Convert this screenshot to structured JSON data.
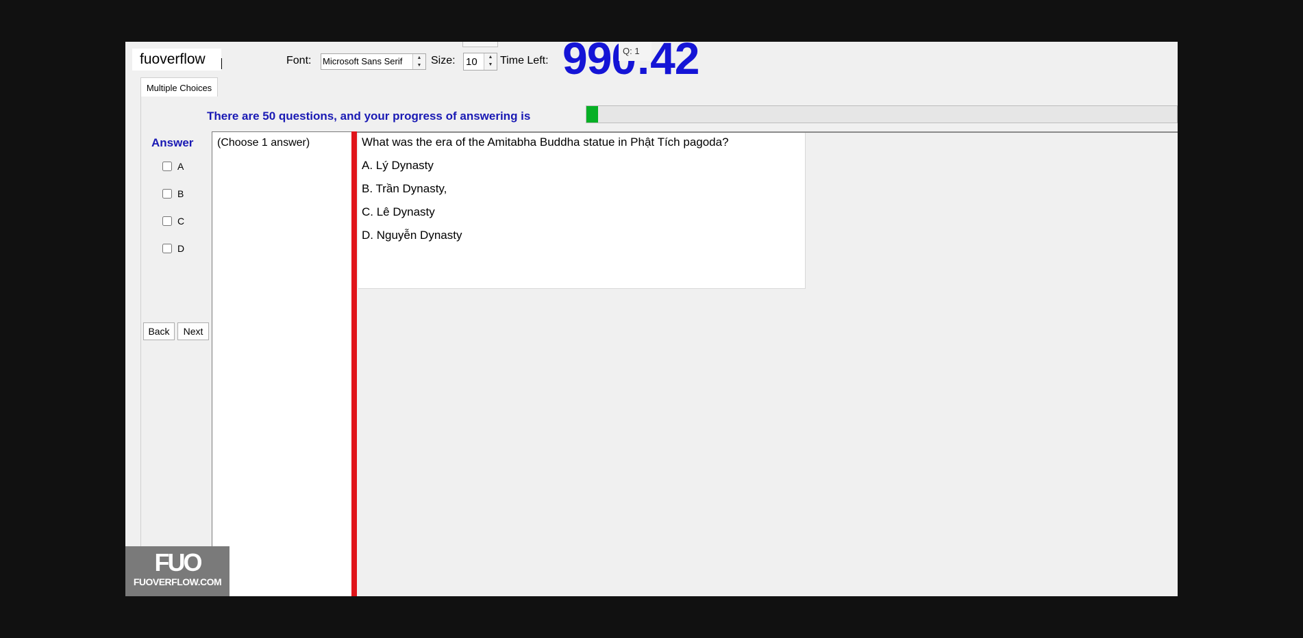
{
  "brand": "fuoverflow",
  "toolbar": {
    "font_label": "Font:",
    "font_value": "Microsoft Sans Serif",
    "size_label": "Size:",
    "size_value": "10",
    "time_label": "Time Left:",
    "timer": "990:42",
    "question_tooltip": "Q: 1"
  },
  "tab": "Multiple Choices",
  "progress": {
    "text": "There are 50 questions, and your progress of answering is",
    "fraction": 0.02,
    "fill_color": "#06b025"
  },
  "answer": {
    "title": "Answer",
    "options": [
      "A",
      "B",
      "C",
      "D"
    ]
  },
  "buttons": {
    "back": "Back",
    "next": "Next"
  },
  "choose_hint": "(Choose 1 answer)",
  "question": {
    "text": "What was the era of the Amitabha Buddha statue in Phật Tích pagoda?",
    "answers": [
      "A.  Lý Dynasty",
      "B.  Trần Dynasty,",
      "C.  Lê Dynasty",
      "D.  Nguyễn Dynasty"
    ]
  },
  "watermark": {
    "logo": "FUO",
    "site": "FUOVERFLOW.COM"
  },
  "colors": {
    "accent_blue": "#1414d6",
    "label_blue": "#1a1ab4",
    "divider_red": "#e0141a"
  }
}
